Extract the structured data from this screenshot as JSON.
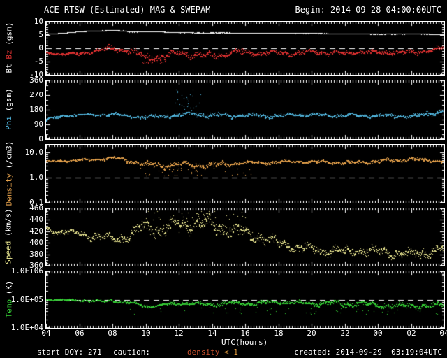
{
  "title": {
    "left": "ACE RTSW (Estimated) MAG & SWEPAM",
    "right": "Begin: 2014-09-28 04:00:00UTC"
  },
  "x_axis": {
    "label": "UTC(hours)",
    "tick_labels": [
      "04",
      "06",
      "08",
      "10",
      "12",
      "14",
      "16",
      "18",
      "20",
      "22",
      "00",
      "02",
      "04"
    ],
    "start_hour": 4,
    "end_hour": 28,
    "minor_tick_minutes": 10
  },
  "footer": {
    "start_doy": "start DOY: 271",
    "caution_label": "caution:",
    "caution_value_parts": [
      {
        "text": "density",
        "color": "#c6502e"
      },
      {
        "text": " < 1",
        "color": "#e29a3e"
      }
    ],
    "created": "created: 2014-09-29  03:19:04UTC"
  },
  "colors": {
    "background": "#000000",
    "frame": "#ffffff",
    "dashed_line": "#ffffff"
  },
  "chart_data": [
    {
      "name": "mag-bt-bz",
      "type": "scatter",
      "scale": "linear",
      "ylim": [
        -10,
        10
      ],
      "ytick_values": [
        10,
        5,
        0,
        -5,
        -10
      ],
      "ytick_labels": [
        "10",
        "5",
        "0",
        "-5",
        "-10"
      ],
      "minor_step": 1,
      "dashed_at": 0,
      "axis_label_parts": [
        {
          "text": "Bt ",
          "color": "#ffffff"
        },
        {
          "text": "Bz",
          "color": "#df3030"
        },
        {
          "text": " (gsm)",
          "color": "#ffffff"
        }
      ],
      "series": [
        {
          "name": "Bt",
          "color": "#f8f8f8",
          "style": "trace",
          "count": 1400,
          "values": [
            5.3,
            5.8,
            6.3,
            6.6,
            6.9,
            6.3,
            6.4,
            6.2,
            6.0,
            5.9,
            5.9,
            5.9,
            5.8,
            5.8,
            5.8,
            5.7,
            5.7,
            5.6,
            5.6,
            5.5,
            5.4,
            5.4,
            5.5,
            5.4,
            5.2
          ],
          "spread": [
            0.12,
            0.12,
            0.12,
            0.12,
            0.15,
            0.45,
            0.2,
            0.15,
            0.2,
            0.15,
            0.15,
            0.12,
            0.15,
            0.12,
            0.12,
            0.12,
            0.12,
            0.12,
            0.12,
            0.12,
            0.12,
            0.12,
            0.15,
            0.2,
            0.25
          ]
        },
        {
          "name": "Bz",
          "color": "#df3030",
          "style": "scatter",
          "count": 1300,
          "values": [
            -1.6,
            -2.1,
            -1.8,
            -0.9,
            0.3,
            -0.8,
            -3.2,
            -3.0,
            -1.6,
            -2.4,
            -2.8,
            -1.6,
            -1.2,
            -1.9,
            -1.5,
            -1.9,
            -1.1,
            -1.5,
            -1.8,
            -1.2,
            -1.5,
            -1.2,
            -1.5,
            -0.8,
            0.2
          ],
          "spread": [
            0.5,
            0.5,
            0.6,
            0.9,
            1.1,
            1.3,
            1.4,
            1.3,
            1.5,
            1.5,
            1.4,
            1.3,
            1.3,
            1.2,
            1.2,
            1.1,
            1.0,
            1.0,
            1.0,
            1.0,
            1.0,
            1.0,
            1.0,
            0.9,
            0.9
          ],
          "outburst": {
            "t_range": [
              9.8,
              11.3
            ],
            "value_range": [
              -5.6,
              -4.2
            ],
            "count": 28
          }
        }
      ]
    },
    {
      "name": "phi",
      "type": "scatter",
      "scale": "linear",
      "ylim": [
        0,
        360
      ],
      "ytick_values": [
        360,
        270,
        180,
        90,
        0
      ],
      "ytick_labels": [
        "360",
        "270",
        "180",
        "90",
        "0"
      ],
      "minor_step": 30,
      "dashed_at": null,
      "axis_label_parts": [
        {
          "text": "Phi",
          "color": "#4fb2d9"
        },
        {
          "text": " (gsm)",
          "color": "#ffffff"
        }
      ],
      "series": [
        {
          "name": "Phi",
          "color": "#4fb2d9",
          "style": "scatter",
          "count": 1250,
          "values": [
            122,
            146,
            152,
            152,
            155,
            142,
            136,
            142,
            150,
            158,
            148,
            146,
            150,
            142,
            146,
            150,
            154,
            146,
            150,
            146,
            150,
            142,
            146,
            152,
            182
          ],
          "spread": [
            8,
            7,
            7,
            7,
            8,
            10,
            14,
            13,
            14,
            18,
            20,
            16,
            15,
            15,
            13,
            13,
            12,
            12,
            12,
            12,
            12,
            13,
            13,
            15,
            22
          ],
          "outburst": {
            "t_range": [
              11.7,
              13.4
            ],
            "value_range": [
              170,
              310
            ],
            "count": 26
          }
        }
      ]
    },
    {
      "name": "density",
      "type": "scatter",
      "scale": "log",
      "ylim": [
        0.1,
        20
      ],
      "ytick_values": [
        10,
        1,
        0.1
      ],
      "ytick_labels": [
        "10.0",
        "1.0",
        "0.1"
      ],
      "dashed_at": 1,
      "axis_label_parts": [
        {
          "text": "Density",
          "color": "#e5a14b"
        },
        {
          "text": " (/cm3)",
          "color": "#ffffff"
        }
      ],
      "series": [
        {
          "name": "Density",
          "color": "#e5a14b",
          "style": "scatter",
          "count": 1250,
          "values": [
            4.5,
            4.8,
            5.0,
            5.4,
            6.2,
            4.8,
            3.4,
            3.0,
            3.6,
            3.0,
            3.2,
            3.5,
            4.0,
            4.0,
            4.2,
            4.5,
            4.5,
            4.3,
            4.0,
            4.2,
            4.5,
            5.0,
            5.6,
            5.0,
            4.6
          ],
          "spread": [
            0.04,
            0.04,
            0.05,
            0.06,
            0.06,
            0.08,
            0.12,
            0.12,
            0.12,
            0.14,
            0.12,
            0.1,
            0.09,
            0.08,
            0.07,
            0.06,
            0.06,
            0.06,
            0.07,
            0.07,
            0.08,
            0.08,
            0.08,
            0.07,
            0.06
          ],
          "outburst": {
            "t_range": [
              9.5,
              16.5
            ],
            "value_range": [
              1.2,
              2.8
            ],
            "count": 40
          }
        }
      ]
    },
    {
      "name": "speed",
      "type": "scatter",
      "scale": "linear",
      "ylim": [
        360,
        460
      ],
      "ytick_values": [
        460,
        440,
        420,
        400,
        380,
        360
      ],
      "ytick_labels": [
        "460",
        "440",
        "420",
        "400",
        "380",
        "360"
      ],
      "minor_step": 5,
      "dashed_at": null,
      "axis_label_parts": [
        {
          "text": "Speed",
          "color": "#e8e58f"
        },
        {
          "text": " (km/s)",
          "color": "#ffffff"
        }
      ],
      "series": [
        {
          "name": "Speed",
          "color": "#e8e58f",
          "style": "scatter",
          "count": 1150,
          "values": [
            424,
            420,
            416,
            411,
            406,
            414,
            428,
            424,
            432,
            436,
            430,
            424,
            419,
            410,
            400,
            394,
            390,
            386,
            385,
            388,
            385,
            382,
            381,
            385,
            389
          ],
          "spread": [
            6,
            6,
            7,
            8,
            8,
            11,
            14,
            15,
            15,
            15,
            15,
            14,
            13,
            12,
            10,
            10,
            9,
            9,
            9,
            10,
            10,
            9,
            9,
            10,
            11
          ],
          "outburst": {
            "t_range": [
              10,
              16
            ],
            "value_range": [
              440,
              456
            ],
            "count": 36
          }
        }
      ]
    },
    {
      "name": "temp",
      "type": "scatter",
      "scale": "log",
      "ylim": [
        10000,
        1000000
      ],
      "ytick_values": [
        1000000,
        100000,
        10000
      ],
      "ytick_labels": [
        "1.0E+06",
        "1.0E+05",
        "1.0E+04"
      ],
      "dashed_at": 100000,
      "axis_label_parts": [
        {
          "text": "Temp",
          "color": "#35d035"
        },
        {
          "text": " (K)",
          "color": "#ffffff"
        }
      ],
      "series": [
        {
          "name": "Temp",
          "color": "#35d035",
          "style": "scatter",
          "count": 1250,
          "values": [
            105000,
            100000,
            98000,
            90000,
            95000,
            78000,
            60000,
            65000,
            80000,
            75000,
            70000,
            78000,
            75000,
            80000,
            85000,
            80000,
            75000,
            80000,
            70000,
            75000,
            65000,
            60000,
            65000,
            60000,
            65000
          ],
          "spread": [
            0.02,
            0.03,
            0.05,
            0.05,
            0.05,
            0.07,
            0.06,
            0.06,
            0.08,
            0.08,
            0.08,
            0.08,
            0.08,
            0.08,
            0.08,
            0.08,
            0.08,
            0.09,
            0.1,
            0.1,
            0.1,
            0.12,
            0.12,
            0.12,
            0.12
          ],
          "outburst": {
            "t_range": [
              9,
              28
            ],
            "value_range": [
              30000,
              56000
            ],
            "count": 55
          }
        }
      ]
    }
  ]
}
